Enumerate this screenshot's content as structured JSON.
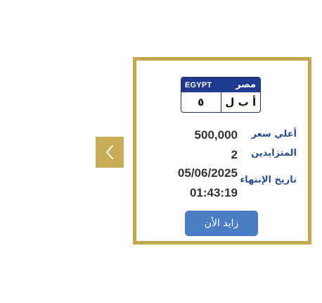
{
  "navigation": {
    "prev_icon": "chevron-left-icon",
    "prev_color": "#c8ac58"
  },
  "card": {
    "border_color": "#c3a650",
    "plate": {
      "country_en": "EGYPT",
      "country_ar": "مصر",
      "letters": "أ ب ل",
      "numbers": "٥",
      "header_color": "#1f3a8f"
    },
    "highest_price": {
      "label": "أعلي سعر",
      "value": "500,000"
    },
    "bidders": {
      "label": "المتزايدين",
      "value": "2"
    },
    "expiry": {
      "label": "تاريخ الإنتهاء",
      "date": "05/06/2025",
      "time": "01:43:19"
    },
    "bid_button": {
      "label": "زايد الأن",
      "color": "#4a7dc3"
    }
  }
}
